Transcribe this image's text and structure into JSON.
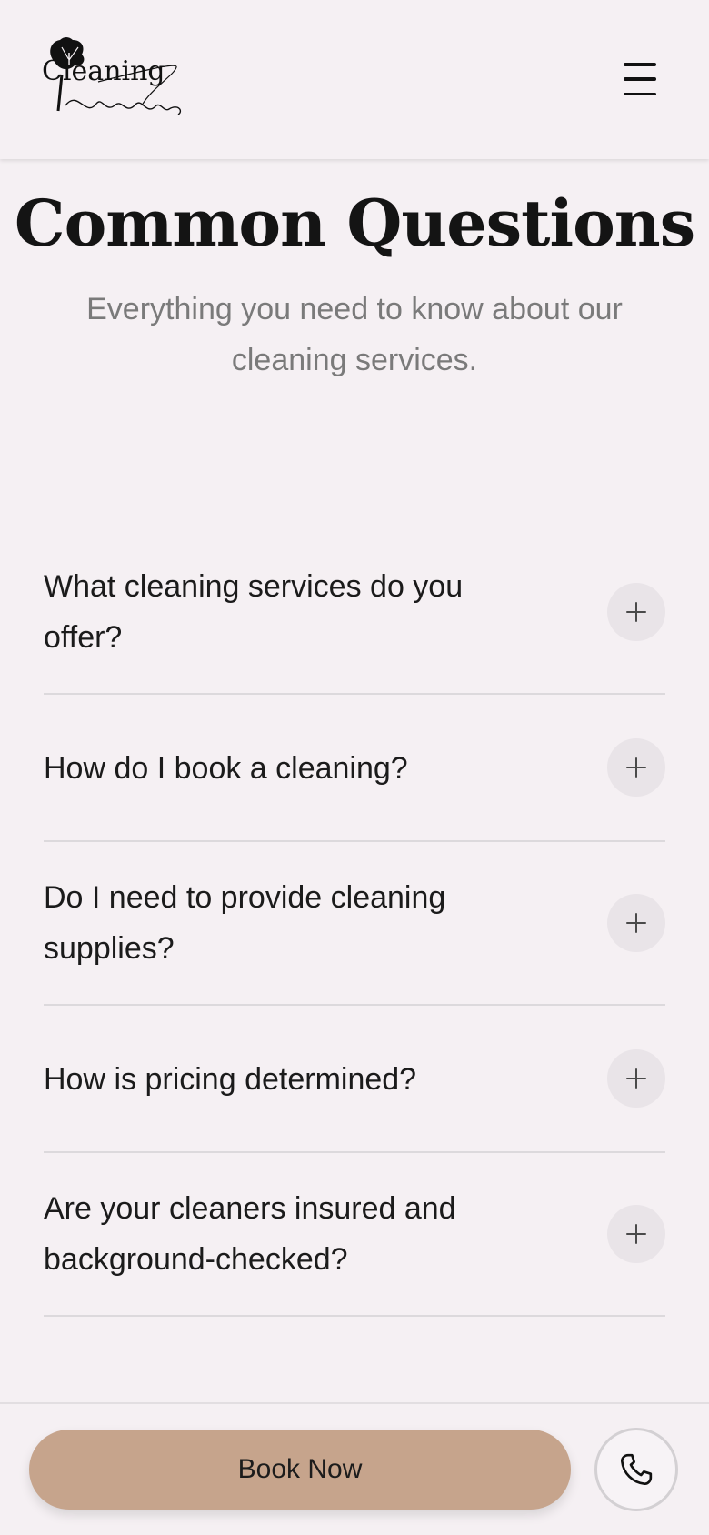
{
  "header": {
    "logo_text": "Cleaning Ideals",
    "menu_icon": "hamburger-menu-icon"
  },
  "hero": {
    "title": "Common Questions",
    "subtitle": "Everything you need to know about our cleaning services."
  },
  "faq": {
    "toggle_icon": "plus-icon",
    "items": [
      {
        "question": "What cleaning services do you offer?"
      },
      {
        "question": "How do I book a cleaning?"
      },
      {
        "question": "Do I need to provide cleaning supplies?"
      },
      {
        "question": "How is pricing determined?"
      },
      {
        "question": "Are your cleaners insured and background-checked?"
      }
    ]
  },
  "bottom_bar": {
    "book_label": "Book Now",
    "phone_icon": "phone-icon"
  },
  "colors": {
    "background": "#f5f0f3",
    "accent": "#c6a48c",
    "toggle_bg": "#e9e4e8",
    "divider": "#dcd9dc"
  }
}
